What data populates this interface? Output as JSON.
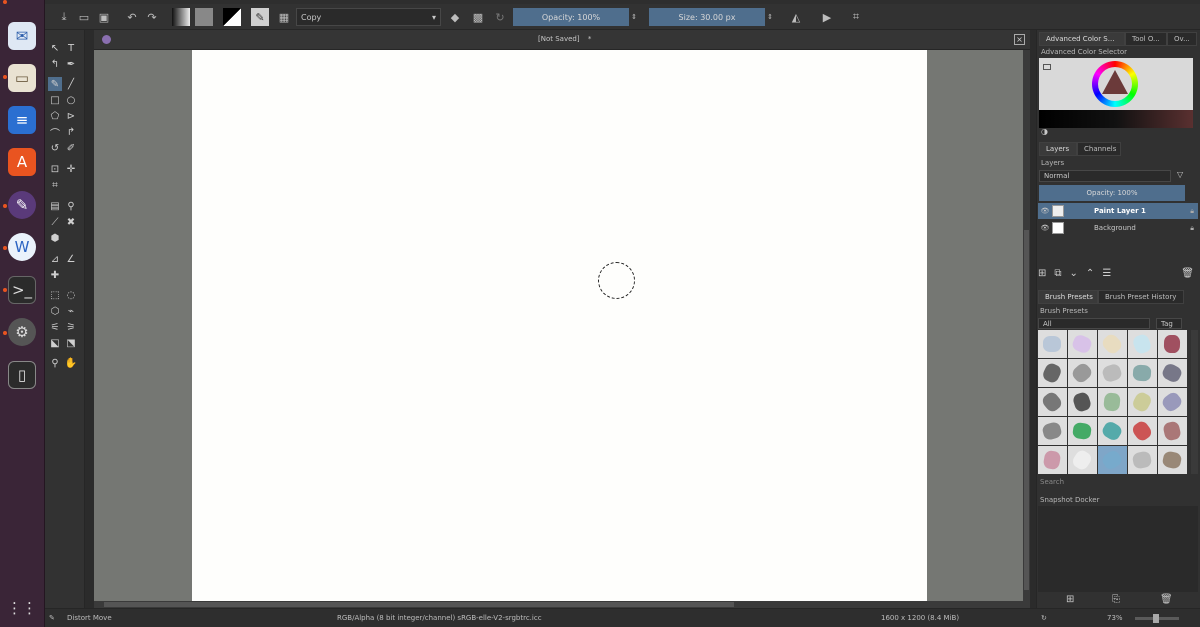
{
  "toolbar": {
    "blend_mode": "Copy",
    "opacity_label": "Opacity: 100%",
    "size_label": "Size: 30.00 px"
  },
  "document": {
    "tab_title": "[Not Saved]",
    "tab_marker": "*"
  },
  "dockers": {
    "top_tabs": [
      "Advanced Color S...",
      "Tool O...",
      "Ov..."
    ],
    "color_selector_title": "Advanced Color Selector",
    "layers_tabs": [
      "Layers",
      "Channels"
    ],
    "layers_title": "Layers",
    "layers_blend": "Normal",
    "layers_opacity": "Opacity:  100%",
    "layers": [
      {
        "name": "Paint Layer 1",
        "selected": true
      },
      {
        "name": "Background",
        "selected": false
      }
    ],
    "brush_tabs": [
      "Brush Presets",
      "Brush Preset History"
    ],
    "brush_presets_title": "Brush Presets",
    "brush_filter": "All",
    "brush_tag": "Tag",
    "search_placeholder": "Search",
    "snapshot_title": "Snapshot Docker"
  },
  "status": {
    "tool": "Distort Move",
    "color_space": "RGB/Alpha (8 bit integer/channel)  sRGB-elle-V2-srgbtrc.icc",
    "dimensions": "1600 x 1200 (8.4 MiB)",
    "zoom": "73%"
  },
  "colors": {
    "accent": "#4f6e8d",
    "dock_bg": "#3a2537",
    "canvas_bg": "#757773",
    "paper": "#fefefc"
  }
}
